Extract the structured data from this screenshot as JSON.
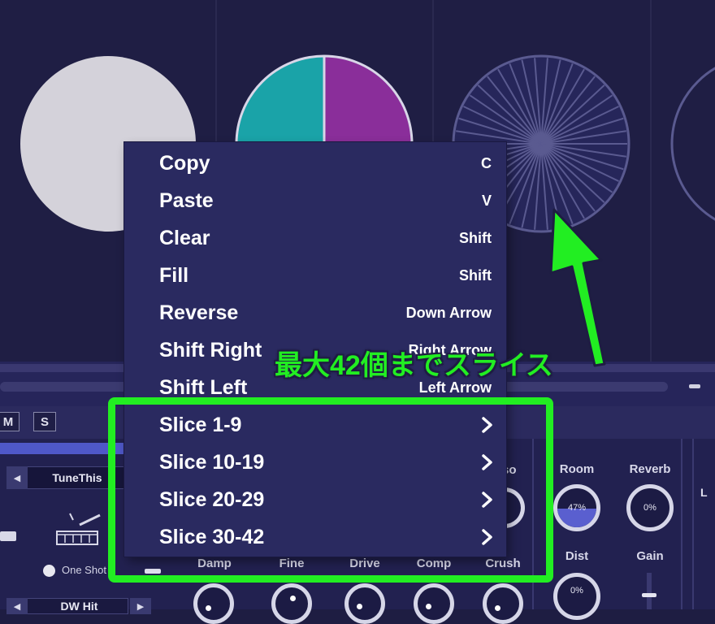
{
  "menu": {
    "items": [
      {
        "label": "Copy",
        "shortcut": "C"
      },
      {
        "label": "Paste",
        "shortcut": "V"
      },
      {
        "label": "Clear",
        "shortcut": "Shift"
      },
      {
        "label": "Fill",
        "shortcut": "Shift"
      },
      {
        "label": "Reverse",
        "shortcut": "Down Arrow"
      },
      {
        "label": "Shift Right",
        "shortcut": "Right Arrow"
      },
      {
        "label": "Shift Left",
        "shortcut": "Left Arrow"
      }
    ],
    "submenus": [
      {
        "label": "Slice 1-9"
      },
      {
        "label": "Slice 10-19"
      },
      {
        "label": "Slice 20-29"
      },
      {
        "label": "Slice 30-42"
      }
    ]
  },
  "track": {
    "mute_label": "M",
    "solo_label": "S",
    "preset_name": "TuneThis",
    "one_shot_label": "One Shot",
    "sample_name": "DW Hit"
  },
  "knobs": {
    "labels": {
      "damp": "Damp",
      "fine": "Fine",
      "drive": "Drive",
      "comp": "Comp",
      "crush": "Crush",
      "room": "Room",
      "reverb": "Reverb",
      "dist": "Dist",
      "gain": "Gain",
      "partial_so": "so"
    },
    "values": {
      "room": "47%",
      "reverb": "0%",
      "dist": "0%"
    },
    "room_level": 0.47
  },
  "channel_label": "L",
  "annotation": {
    "callout": "最大42個までスライス",
    "color": "#22ee22"
  },
  "colors": {
    "pie_teal": "#1aa3a8",
    "pie_purple": "#8a2e9a",
    "pad_white": "#d4d2da",
    "menu_bg": "#2a2a60"
  },
  "icons": {
    "submenu_arrow": "chevron-right-icon",
    "drum": "drum-icon",
    "speaker": "speaker-icon"
  }
}
